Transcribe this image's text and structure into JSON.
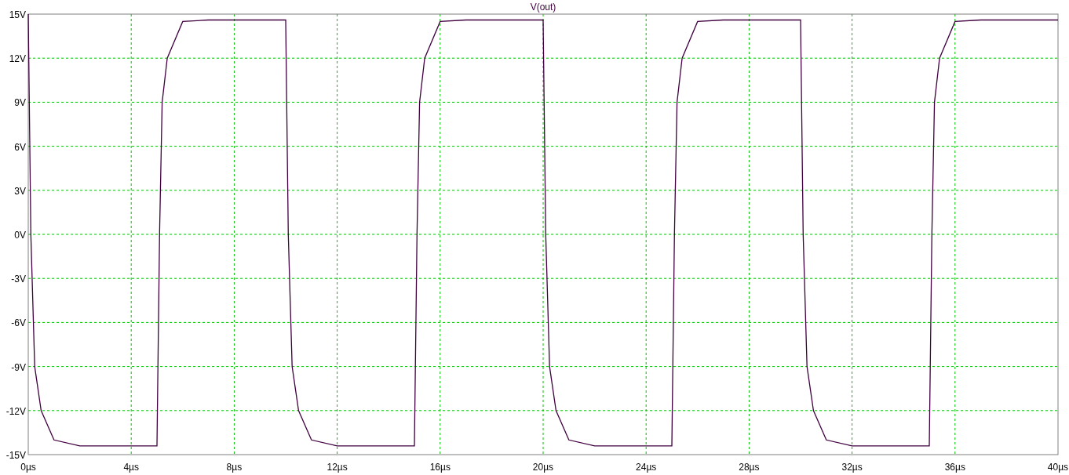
{
  "plot": {
    "chart_data": {
      "type": "line",
      "x": [
        0,
        0.1,
        0.25,
        0.5,
        1,
        2,
        5,
        5.1,
        5.2,
        5.4,
        6,
        7,
        10,
        10.1,
        10.25,
        10.5,
        11,
        12,
        15,
        15.1,
        15.2,
        15.4,
        16,
        17,
        20,
        20.1,
        20.25,
        20.5,
        21,
        22,
        25,
        25.1,
        25.2,
        25.4,
        26,
        27,
        30,
        30.1,
        30.25,
        30.5,
        31,
        32,
        35,
        35.1,
        35.2,
        35.4,
        36,
        37,
        40
      ],
      "series": [
        {
          "name": "V(out)",
          "color": "#400040",
          "values": [
            15,
            0,
            -9,
            -12,
            -14,
            -14.4,
            -14.4,
            0,
            9,
            12,
            14.5,
            14.6,
            14.6,
            0,
            -9,
            -12,
            -14,
            -14.4,
            -14.4,
            0,
            9,
            12,
            14.5,
            14.6,
            14.6,
            0,
            -9,
            -12,
            -14,
            -14.4,
            -14.4,
            0,
            9,
            12,
            14.5,
            14.6,
            14.6,
            0,
            -9,
            -12,
            -14,
            -14.4,
            -14.4,
            0,
            9,
            12,
            14.5,
            14.6,
            14.6
          ]
        }
      ],
      "grid": true,
      "xlim": [
        0,
        40
      ],
      "ylim": [
        -15,
        15
      ],
      "xticks": [
        {
          "value": 0,
          "label": "0µs"
        },
        {
          "value": 4,
          "label": "4µs"
        },
        {
          "value": 8,
          "label": "8µs"
        },
        {
          "value": 12,
          "label": "12µs"
        },
        {
          "value": 16,
          "label": "16µs"
        },
        {
          "value": 20,
          "label": "20µs"
        },
        {
          "value": 24,
          "label": "24µs"
        },
        {
          "value": 28,
          "label": "28µs"
        },
        {
          "value": 32,
          "label": "32µs"
        },
        {
          "value": 36,
          "label": "36µs"
        },
        {
          "value": 40,
          "label": "40µs"
        }
      ],
      "yticks": [
        {
          "value": 15,
          "label": "15V"
        },
        {
          "value": 12,
          "label": "12V"
        },
        {
          "value": 9,
          "label": "9V"
        },
        {
          "value": 6,
          "label": "6V"
        },
        {
          "value": 3,
          "label": "3V"
        },
        {
          "value": 0,
          "label": "0V"
        },
        {
          "value": -3,
          "label": "-3V"
        },
        {
          "value": -6,
          "label": "-6V"
        },
        {
          "value": -9,
          "label": "-9V"
        },
        {
          "value": -12,
          "label": "-12V"
        },
        {
          "value": -15,
          "label": "-15V"
        }
      ]
    }
  }
}
